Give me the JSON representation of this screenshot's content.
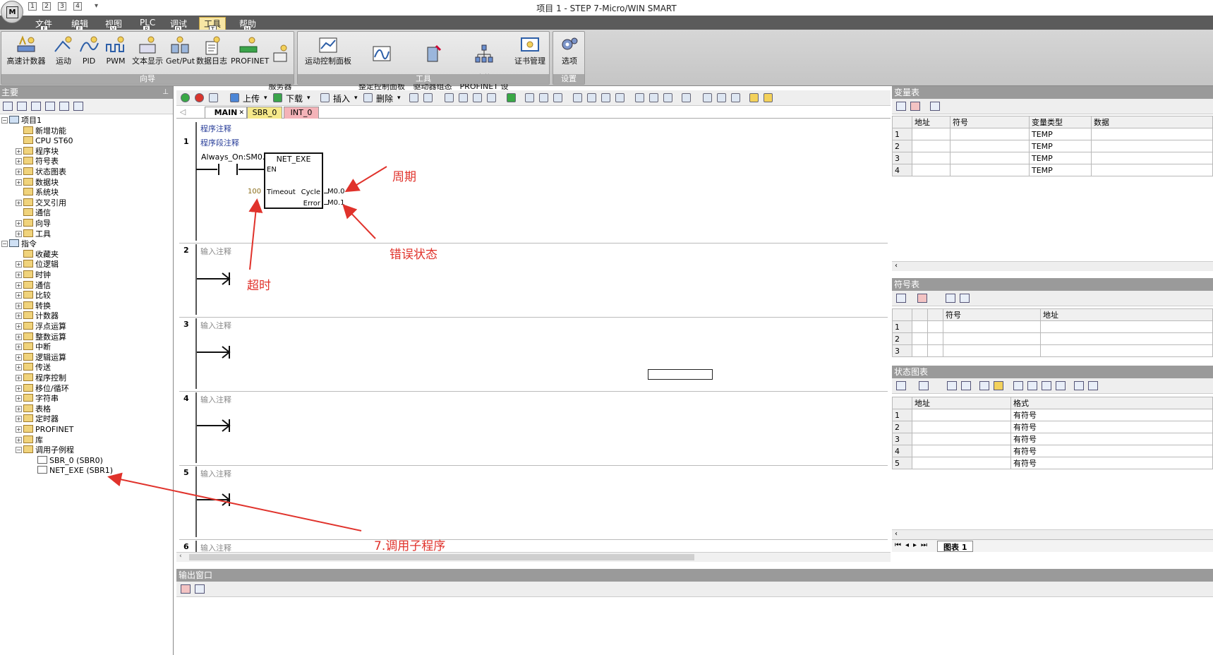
{
  "window": {
    "title": "项目 1 - STEP 7-Micro/WIN SMART",
    "app_button_label": "M",
    "quick_access": [
      "1",
      "2",
      "3",
      "4"
    ]
  },
  "ribbon": {
    "tabs": [
      {
        "label": "文件",
        "key": "F"
      },
      {
        "label": "编辑",
        "key": "E"
      },
      {
        "label": "视图",
        "key": "V"
      },
      {
        "label": "PLC",
        "key": "P"
      },
      {
        "label": "调试",
        "key": "D"
      },
      {
        "label": "工具",
        "key": "T"
      },
      {
        "label": "帮助",
        "key": "H"
      }
    ],
    "active_tab": "工具",
    "groups": [
      {
        "label": "向导",
        "buttons": [
          "高速计数器",
          "运动",
          "PID",
          "PWM",
          "文本显示",
          "Get/Put",
          "数据日志",
          "PROFINET",
          "Web\n服务器"
        ]
      },
      {
        "label": "工具",
        "buttons": [
          "运动控制面板",
          "PID\n整定控制面板",
          "SMART\n驱动器组态",
          "查找\nPROFINET 设备",
          "证书管理"
        ]
      },
      {
        "label": "设置",
        "buttons": [
          "选项"
        ]
      }
    ]
  },
  "project_tree": {
    "header": "主要",
    "items": [
      {
        "label": "项目1",
        "level": 0,
        "exp": "⊟"
      },
      {
        "label": "新增功能",
        "level": 1,
        "exp": ""
      },
      {
        "label": "CPU ST60",
        "level": 1,
        "exp": ""
      },
      {
        "label": "程序块",
        "level": 1,
        "exp": "+"
      },
      {
        "label": "符号表",
        "level": 1,
        "exp": "+"
      },
      {
        "label": "状态图表",
        "level": 1,
        "exp": "+"
      },
      {
        "label": "数据块",
        "level": 1,
        "exp": "+"
      },
      {
        "label": "系统块",
        "level": 1,
        "exp": ""
      },
      {
        "label": "交叉引用",
        "level": 1,
        "exp": "+"
      },
      {
        "label": "通信",
        "level": 1,
        "exp": ""
      },
      {
        "label": "向导",
        "level": 1,
        "exp": "+"
      },
      {
        "label": "工具",
        "level": 1,
        "exp": "+"
      },
      {
        "label": "指令",
        "level": 0,
        "exp": "⊟"
      },
      {
        "label": "收藏夹",
        "level": 1,
        "exp": ""
      },
      {
        "label": "位逻辑",
        "level": 1,
        "exp": "+"
      },
      {
        "label": "时钟",
        "level": 1,
        "exp": "+"
      },
      {
        "label": "通信",
        "level": 1,
        "exp": "+"
      },
      {
        "label": "比较",
        "level": 1,
        "exp": "+"
      },
      {
        "label": "转换",
        "level": 1,
        "exp": "+"
      },
      {
        "label": "计数器",
        "level": 1,
        "exp": "+"
      },
      {
        "label": "浮点运算",
        "level": 1,
        "exp": "+"
      },
      {
        "label": "整数运算",
        "level": 1,
        "exp": "+"
      },
      {
        "label": "中断",
        "level": 1,
        "exp": "+"
      },
      {
        "label": "逻辑运算",
        "level": 1,
        "exp": "+"
      },
      {
        "label": "传送",
        "level": 1,
        "exp": "+"
      },
      {
        "label": "程序控制",
        "level": 1,
        "exp": "+"
      },
      {
        "label": "移位/循环",
        "level": 1,
        "exp": "+"
      },
      {
        "label": "字符串",
        "level": 1,
        "exp": "+"
      },
      {
        "label": "表格",
        "level": 1,
        "exp": "+"
      },
      {
        "label": "定时器",
        "level": 1,
        "exp": "+"
      },
      {
        "label": "PROFINET",
        "level": 1,
        "exp": "+"
      },
      {
        "label": "库",
        "level": 1,
        "exp": "+"
      },
      {
        "label": "调用子例程",
        "level": 1,
        "exp": "⊟"
      },
      {
        "label": "SBR_0 (SBR0)",
        "level": 2,
        "exp": ""
      },
      {
        "label": "NET_EXE (SBR1)",
        "level": 2,
        "exp": ""
      }
    ]
  },
  "editor": {
    "toolbar": {
      "upload": "上传",
      "download": "下载",
      "insert": "插入",
      "delete": "删除"
    },
    "tabs": [
      {
        "label": "MAIN",
        "color": "#ffffff"
      },
      {
        "label": "SBR_0",
        "color": "#f6e98a"
      },
      {
        "label": "INT_0",
        "color": "#f4b3b8"
      }
    ],
    "program_comment": "程序注释",
    "networks": [
      {
        "no": "1",
        "comment": "程序段注释"
      },
      {
        "no": "2",
        "comment": "输入注释"
      },
      {
        "no": "3",
        "comment": "输入注释"
      },
      {
        "no": "4",
        "comment": "输入注释"
      },
      {
        "no": "5",
        "comment": "输入注释"
      },
      {
        "no": "6",
        "comment": "输入注释"
      }
    ],
    "block": {
      "contact": "Always_On:SM0.0",
      "name": "NET_EXE",
      "en": "EN",
      "timeout_pin": "Timeout",
      "timeout_val": "100",
      "cycle_pin": "Cycle",
      "cycle_val": "M0.0",
      "error_pin": "Error",
      "error_val": "M0.1"
    },
    "annotations": {
      "period": "周期",
      "error_state": "错误状态",
      "timeout": "超时",
      "call_sub": "7.调用子程序"
    }
  },
  "var_table": {
    "header": "变量表",
    "columns": [
      "地址",
      "符号",
      "变量类型",
      "数据"
    ],
    "rows": [
      {
        "n": "1",
        "type": "TEMP"
      },
      {
        "n": "2",
        "type": "TEMP"
      },
      {
        "n": "3",
        "type": "TEMP"
      },
      {
        "n": "4",
        "type": "TEMP"
      }
    ]
  },
  "symbol_table": {
    "header": "符号表",
    "columns": [
      "符号",
      "地址"
    ],
    "rows": [
      "1",
      "2",
      "3"
    ]
  },
  "status_chart": {
    "header": "状态图表",
    "columns": [
      "地址",
      "格式"
    ],
    "rows": [
      {
        "n": "1",
        "fmt": "有符号"
      },
      {
        "n": "2",
        "fmt": "有符号"
      },
      {
        "n": "3",
        "fmt": "有符号"
      },
      {
        "n": "4",
        "fmt": "有符号"
      },
      {
        "n": "5",
        "fmt": "有符号"
      }
    ],
    "sheet_tab": "图表 1"
  },
  "output_window": {
    "header": "输出窗口"
  },
  "colors": {
    "accent": "#e0322b",
    "ribbon_dark": "#5b5b5b",
    "panel_header": "#9a9a9a"
  }
}
